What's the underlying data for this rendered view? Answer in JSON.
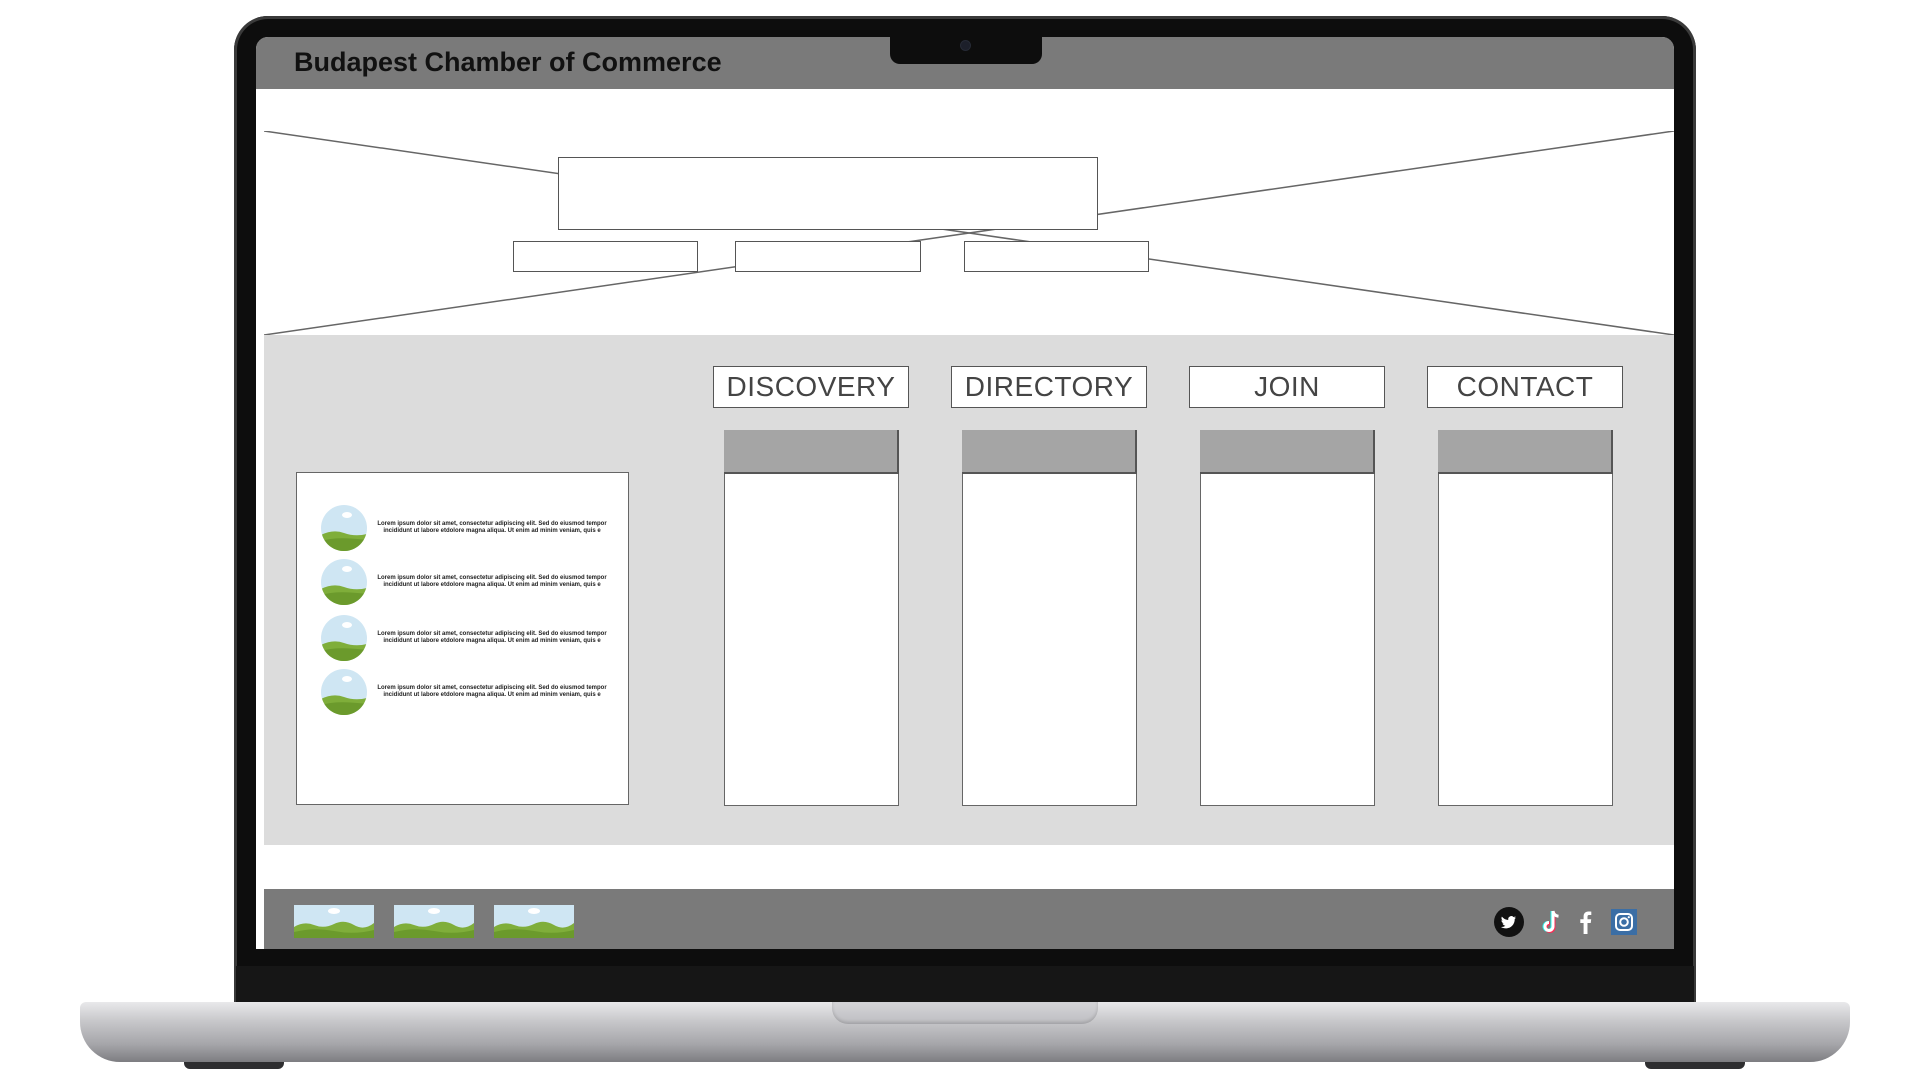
{
  "header": {
    "title": "Budapest Chamber of Commerce"
  },
  "nav": {
    "items": [
      {
        "label": "DISCOVERY"
      },
      {
        "label": "DIRECTORY"
      },
      {
        "label": "JOIN"
      },
      {
        "label": "CONTACT"
      }
    ]
  },
  "news": {
    "items": [
      {
        "text": "Lorem ipsum dolor sit amet, consectetur adipiscing elit. Sed do eiusmod tempor incididunt ut labore etdolore magna aliqua. Ut enim ad minim veniam, quis e"
      },
      {
        "text": "Lorem ipsum dolor sit amet, consectetur adipiscing elit. Sed do eiusmod tempor incididunt ut labore etdolore magna aliqua. Ut enim ad minim veniam, quis e"
      },
      {
        "text": "Lorem ipsum dolor sit amet, consectetur adipiscing elit. Sed do eiusmod tempor incididunt ut labore etdolore magna aliqua. Ut enim ad minim veniam, quis e"
      },
      {
        "text": "Lorem ipsum dolor sit amet, consectetur adipiscing elit. Sed do eiusmod tempor incididunt ut labore etdolore magna aliqua. Ut enim ad minim veniam, quis e"
      }
    ]
  },
  "footer": {
    "social": [
      "twitter-icon",
      "tiktok-icon",
      "facebook-icon",
      "instagram-icon"
    ]
  },
  "colors": {
    "header_bg": "#7a7a7a",
    "main_bg": "#dcdcdc",
    "column_head": "#a5a5a5",
    "frame": "#0d0d0d"
  }
}
